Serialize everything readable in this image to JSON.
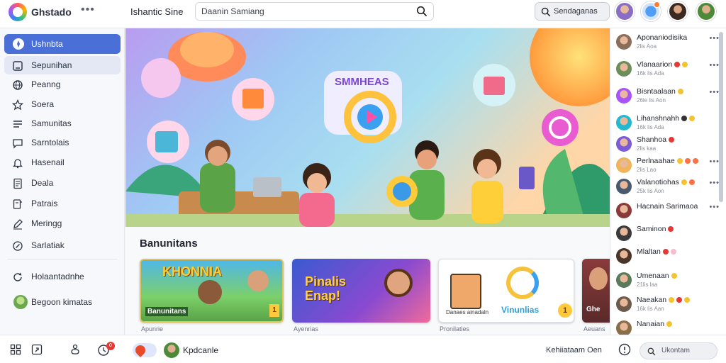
{
  "header": {
    "app_name": "Ghstado",
    "site_title": "Ishantic Sine",
    "search_placeholder": "Daanin Samiang",
    "search_button_label": "Sendaganas",
    "more_icon": "more-dots-icon"
  },
  "sidebar": {
    "items": [
      {
        "label": "Ushnbta",
        "icon": "compass-icon",
        "state": "active"
      },
      {
        "label": "Sepunihan",
        "icon": "square-icon",
        "state": "hover"
      },
      {
        "label": "Peanng",
        "icon": "globe-icon"
      },
      {
        "label": "Soera",
        "icon": "star-icon"
      },
      {
        "label": "Samunitas",
        "icon": "list-icon"
      },
      {
        "label": "Sarntolais",
        "icon": "chat-icon"
      },
      {
        "label": "Hasenail",
        "icon": "bell-icon"
      },
      {
        "label": "Deala",
        "icon": "document-icon"
      },
      {
        "label": "Patrais",
        "icon": "folder-icon"
      },
      {
        "label": "Meringg",
        "icon": "edit-icon"
      },
      {
        "label": "Sarlatiak",
        "icon": "link-icon"
      }
    ],
    "footer_items": [
      {
        "label": "Holaantadnhe",
        "icon": "refresh-icon"
      },
      {
        "label": "Begoon kimatas",
        "icon": "group-avatar"
      }
    ]
  },
  "main": {
    "hero_sign": "SMMHEAS",
    "section_title": "Banunitans",
    "cards": [
      {
        "title": "KHONNIA",
        "caption_top": "Banunitans",
        "label": "Banunitans",
        "badge": "1",
        "sub": "Apunrie"
      },
      {
        "title": "Pinalis Enap!",
        "label": "",
        "sub": "Ayenrias"
      },
      {
        "title": "Vinunlias",
        "label": "Danaes ainadaln",
        "badge": "1",
        "sub": "Pronilaties"
      },
      {
        "title": "",
        "label": "Ghe",
        "sub": "Aeuans"
      }
    ]
  },
  "right_panel": {
    "rows": [
      {
        "name": "Aponaniodisika",
        "sub": "2lis Aoa",
        "emojis": [],
        "has_menu": true,
        "avatar": "#8a6e5a"
      },
      {
        "name": "Vlanaarion",
        "sub": "16k lis Ada",
        "emojis": [
          "#e53935",
          "#f4c430"
        ],
        "has_menu": true,
        "avatar": "#6b8e5a"
      },
      {
        "name": "Bisntaalaan",
        "sub": "26le lis Aon",
        "emojis": [
          "#f4c430"
        ],
        "has_menu": true,
        "avatar": "#a855f7"
      },
      {
        "name": "Lihanshnahh",
        "sub": "16k lis Ada",
        "emojis": [
          "#333333",
          "#f4c430"
        ],
        "has_menu": false,
        "avatar": "#22b8cf"
      },
      {
        "name": "Shanhoa",
        "sub": "2lis kaa",
        "emojis": [
          "#e53935"
        ],
        "has_menu": false,
        "avatar": "#7c5cd6"
      },
      {
        "name": "Perlnaahae",
        "sub": "2lis Lao",
        "emojis": [
          "#f4c430",
          "#ff7043",
          "#ff7043"
        ],
        "has_menu": true,
        "avatar": "#f0b45a"
      },
      {
        "name": "Valanotiohas",
        "sub": "25k lis Aon",
        "emojis": [
          "#f4c430",
          "#ff7043"
        ],
        "has_menu": true,
        "avatar": "#4a5a6e"
      },
      {
        "name": "Hacnain Sarimaoa",
        "sub": "",
        "emojis": [],
        "has_menu": true,
        "avatar": "#8b3a3a"
      },
      {
        "name": "Saminon",
        "sub": "",
        "emojis": [
          "#e53935"
        ],
        "has_menu": false,
        "avatar": "#3a3a3a"
      },
      {
        "name": "Mlaltan",
        "sub": "",
        "emojis": [
          "#e53935",
          "#f8bbd0"
        ],
        "has_menu": false,
        "avatar": "#4a3628"
      },
      {
        "name": "Umenaan",
        "sub": "21lis laa",
        "emojis": [
          "#f4c430"
        ],
        "has_menu": false,
        "avatar": "#5a7a5a"
      },
      {
        "name": "Naeakan",
        "sub": "16k lis Aan",
        "emojis": [
          "#f4c430",
          "#e53935",
          "#f4c430"
        ],
        "has_menu": false,
        "avatar": "#6e5a4a"
      },
      {
        "name": "Nanaian",
        "sub": "",
        "emojis": [
          "#f4c430"
        ],
        "has_menu": false,
        "avatar": "#8a6e4a"
      }
    ]
  },
  "bottom_bar": {
    "notif_count": "0",
    "user_name": "Kpdcanle",
    "status_text": "Kehiiataam Oen",
    "search_label": "Ukontam"
  }
}
